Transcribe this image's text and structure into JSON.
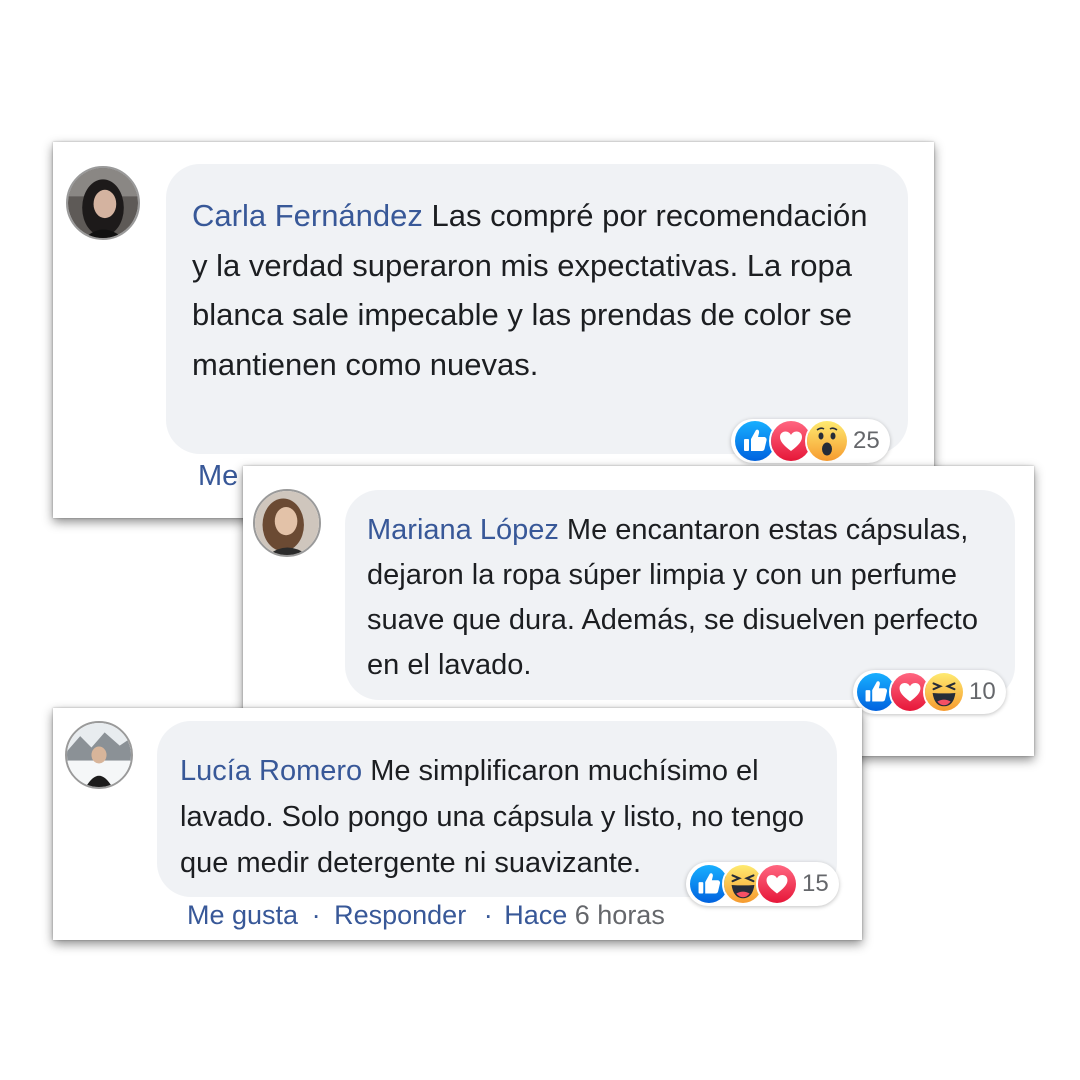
{
  "comments": [
    {
      "author": "Carla Fernández",
      "text": "Las compré por recomendación y la verdad superaron mis expectativas. La ropa blanca sale impecable y las prendas de color se mantienen como nuevas.",
      "reaction_count": "25",
      "reactions": [
        "like-icon",
        "love-icon",
        "wow-icon"
      ],
      "actions_partial": "Me"
    },
    {
      "author": "Mariana López",
      "text": "Me encantaron estas cápsulas, dejaron la ropa súper limpia y con un perfume suave que dura. Además, se disuelven perfecto en el lavado.",
      "reaction_count": "10",
      "reactions": [
        "like-icon",
        "love-icon",
        "haha-icon"
      ]
    },
    {
      "author": "Lucía Romero",
      "text": "Me simplificaron muchísimo el lavado. Solo pongo una cápsula y listo, no tengo que medir detergente ni suavizante.",
      "reaction_count": "15",
      "reactions": [
        "like-icon",
        "haha-icon",
        "love-icon"
      ],
      "actions": {
        "like": "Me gusta",
        "reply": "Responder",
        "separator": "·",
        "ago_prefix": "Hace",
        "time": "6 horas"
      }
    }
  ],
  "colors": {
    "name": "#385898",
    "bubble": "#f0f2f5",
    "like": "#1877f2",
    "love": "#f33e58",
    "emoji": "#f7b125"
  }
}
